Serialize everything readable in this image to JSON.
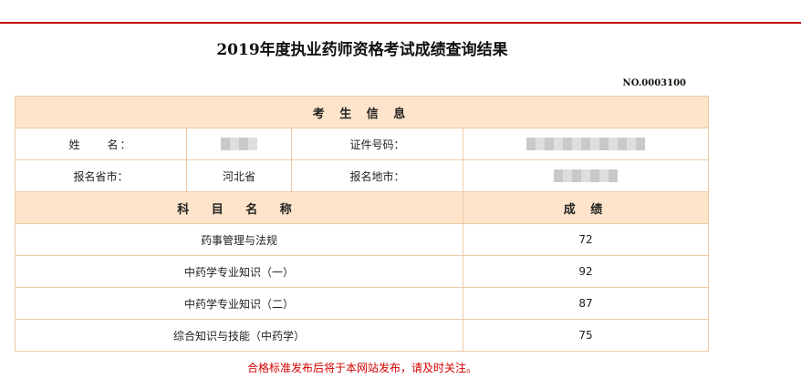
{
  "title": "2019年度执业药师资格考试成绩查询结果",
  "serial_no": "NO.0003100",
  "candidate_section": {
    "header": "考 生 信 息",
    "name_label": "姓　　名：",
    "id_label": "证件号码：",
    "province_label": "报名省市：",
    "province_value": "河北省",
    "city_label": "报名地市："
  },
  "scores_section": {
    "subject_header": "科 目 名 称",
    "score_header": "成 绩",
    "rows": [
      {
        "subject": "药事管理与法规",
        "score": "72"
      },
      {
        "subject": "中药学专业知识（一）",
        "score": "92"
      },
      {
        "subject": "中药学专业知识（二）",
        "score": "87"
      },
      {
        "subject": "综合知识与技能（中药学）",
        "score": "75"
      }
    ]
  },
  "notice": "合格标准发布后将于本网站发布，请及时关注。",
  "colors": {
    "accent_red": "#c00000",
    "header_bg": "#fde4ca",
    "border": "#f0c9a5",
    "notice_red": "#d40000"
  }
}
